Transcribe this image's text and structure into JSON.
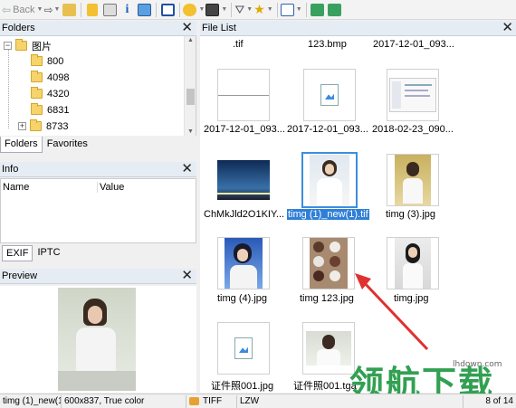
{
  "toolbar": {
    "back_label": "Back",
    "view_mode": "thumbnails"
  },
  "folders": {
    "title": "Folders",
    "root": "图片",
    "items": [
      "800",
      "4098",
      "4320",
      "6831",
      "8733"
    ],
    "tabs": [
      "Folders",
      "Favorites"
    ]
  },
  "info": {
    "title": "Info",
    "columns": [
      "Name",
      "Value"
    ],
    "tabs": [
      "EXIF",
      "IPTC"
    ]
  },
  "preview": {
    "title": "Preview"
  },
  "file_list": {
    "title": "File List",
    "row0": [
      ".tif",
      "123.bmp",
      "2017-12-01_093..."
    ],
    "row1": [
      "2017-12-01_093...",
      "2017-12-01_093...",
      "2018-02-23_090..."
    ],
    "row2": [
      "ChMkJld2O1KIY...",
      "timg (1)_new(1).tif",
      "timg (3).jpg"
    ],
    "row3": [
      "timg (4).jpg",
      "timg 123.jpg",
      "timg.jpg"
    ],
    "row4": [
      "证件照001.jpg",
      "证件照001.tga"
    ]
  },
  "status": {
    "filename": "timg (1)_new(1",
    "dimensions": "600x837, True color",
    "format": "TIFF",
    "compression": "LZW",
    "position": "8 of 14"
  },
  "watermark": {
    "text": "领航下载",
    "url": "lhdown.com"
  },
  "colors": {
    "accent": "#2f7fd7",
    "panel_header": "#e6ecf3",
    "arrow": "#e03030",
    "watermark": "#32a052"
  }
}
